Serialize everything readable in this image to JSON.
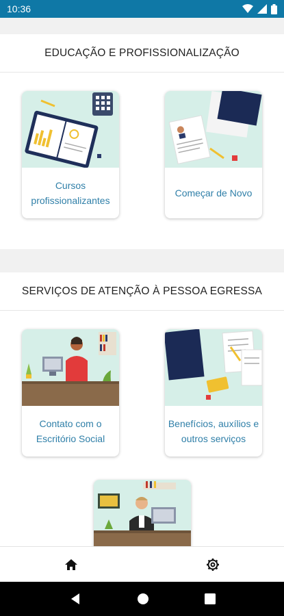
{
  "status_bar": {
    "time": "10:36"
  },
  "sections": [
    {
      "title": "EDUCAÇÃO E PROFISSIONALIZAÇÃO",
      "cards": [
        {
          "label": "Cursos profissionalizantes"
        },
        {
          "label": "Começar de Novo"
        }
      ]
    },
    {
      "title": "SERVIÇOS DE ATENÇÃO À PESSOA EGRESSA",
      "cards": [
        {
          "label": "Contato com o Escritório Social"
        },
        {
          "label": "Benefícios, auxílios e outros serviços"
        }
      ]
    }
  ],
  "bottom_nav": {
    "items": [
      "home-icon",
      "settings-icon"
    ]
  },
  "colors": {
    "status_bar": "#0f78a6",
    "card_label": "#2f7fa8",
    "illustration_bg": "#d6efe8"
  }
}
